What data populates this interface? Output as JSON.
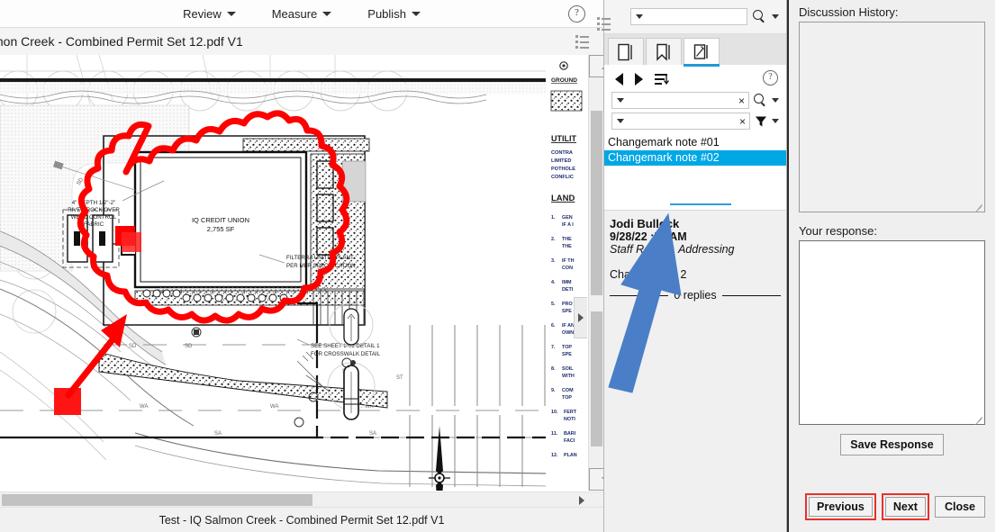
{
  "menubar": {
    "items": [
      {
        "label": "Review"
      },
      {
        "label": "Measure"
      },
      {
        "label": "Publish"
      }
    ],
    "help": "?"
  },
  "document": {
    "title_bar": "mon Creek - Combined Permit Set 12.pdf V1",
    "status_bar": "Test - IQ Salmon Creek - Combined Permit Set 12.pdf V1"
  },
  "search": {
    "value": "",
    "placeholder": ""
  },
  "drawing": {
    "labels": {
      "building_name": "IQ CREDIT UNION",
      "building_area": "2,755 SF",
      "note_river_rock": "4\" DEPTH 1/2\"-2\"\nRIVER ROCK OVER\nWEED CONTROL\nFABRIC",
      "note_filterra": "FILTERRA UNITS - PLANT\nPER MFR SPECIFICATION",
      "note_crosswalk": "SEE SHEET L-02 DETAIL 1\nFOR CROSSWALK DETAIL",
      "pipe_sd_1": "SD",
      "pipe_sd_2": "SD",
      "pipe_wa": "WA",
      "pipe_st": "ST",
      "pipe_sa": "SA"
    },
    "legend": {
      "ground_heading": "GROUND",
      "utility_heading": "UTILIT",
      "utility_lines": [
        "CONTRA",
        "LIMITED",
        "POTHOLE",
        "CONFLIC"
      ],
      "landscape_heading": "LAND",
      "landscape_notes": [
        {
          "n": "1.",
          "l1": "GEN",
          "l2": "IF A I"
        },
        {
          "n": "2.",
          "l1": "THE",
          "l2": "THE"
        },
        {
          "n": "3.",
          "l1": "IF TH",
          "l2": "CON"
        },
        {
          "n": "4.",
          "l1": "IMM",
          "l2": "DETI"
        },
        {
          "n": "5.",
          "l1": "PRO",
          "l2": "SPE"
        },
        {
          "n": "6.",
          "l1": "IF AN",
          "l2": "OWN"
        },
        {
          "n": "7.",
          "l1": "TOP",
          "l2": "SPE"
        },
        {
          "n": "8.",
          "l1": "SOIL",
          "l2": "WITH"
        },
        {
          "n": "9.",
          "l1": "COM",
          "l2": "TOP"
        },
        {
          "n": "10.",
          "l1": "FERT",
          "l2": "NOTI"
        },
        {
          "n": "11.",
          "l1": "BARI",
          "l2": "FACI"
        },
        {
          "n": "12.",
          "l1": "PLAN",
          "l2": ""
        }
      ]
    }
  },
  "changemark_panel": {
    "tabs": [
      {
        "name": "pages",
        "icon": "page-icon",
        "active": false
      },
      {
        "name": "bookmarks",
        "icon": "bookmark-icon",
        "active": false
      },
      {
        "name": "changemarks",
        "icon": "changemark-icon",
        "active": true
      }
    ],
    "toolbar": {
      "prev": "◀",
      "next": "▶",
      "sort": "sort-icon",
      "help": "?"
    },
    "search_field": {
      "value": "",
      "clear": "×"
    },
    "filter_field": {
      "value": "",
      "clear": "×"
    },
    "notes": [
      {
        "label": "Changemark note #01",
        "selected": false
      },
      {
        "label": "Changemark note #02",
        "selected": true
      }
    ],
    "detail": {
      "author": "Jodi Bullock",
      "date": "9/28/22  :55 AM",
      "status": "Staff Review, Addressing",
      "body": "Change Mark 2",
      "replies": "0 replies"
    }
  },
  "discussion": {
    "history_label": "Discussion History:",
    "history_value": "",
    "response_label": "Your response:",
    "response_value": "",
    "save_label": "Save Response",
    "buttons": [
      {
        "label": "Previous",
        "highlighted": true
      },
      {
        "label": "Next",
        "highlighted": true
      },
      {
        "label": "Close",
        "highlighted": false
      }
    ]
  },
  "colors": {
    "selection_blue": "#00a7e5",
    "tab_underline": "#1f9bd8",
    "annotation_red": "#ff0000",
    "annotation_arrow_blue": "#4a7ec7",
    "highlight_border_red": "#e8312a"
  }
}
